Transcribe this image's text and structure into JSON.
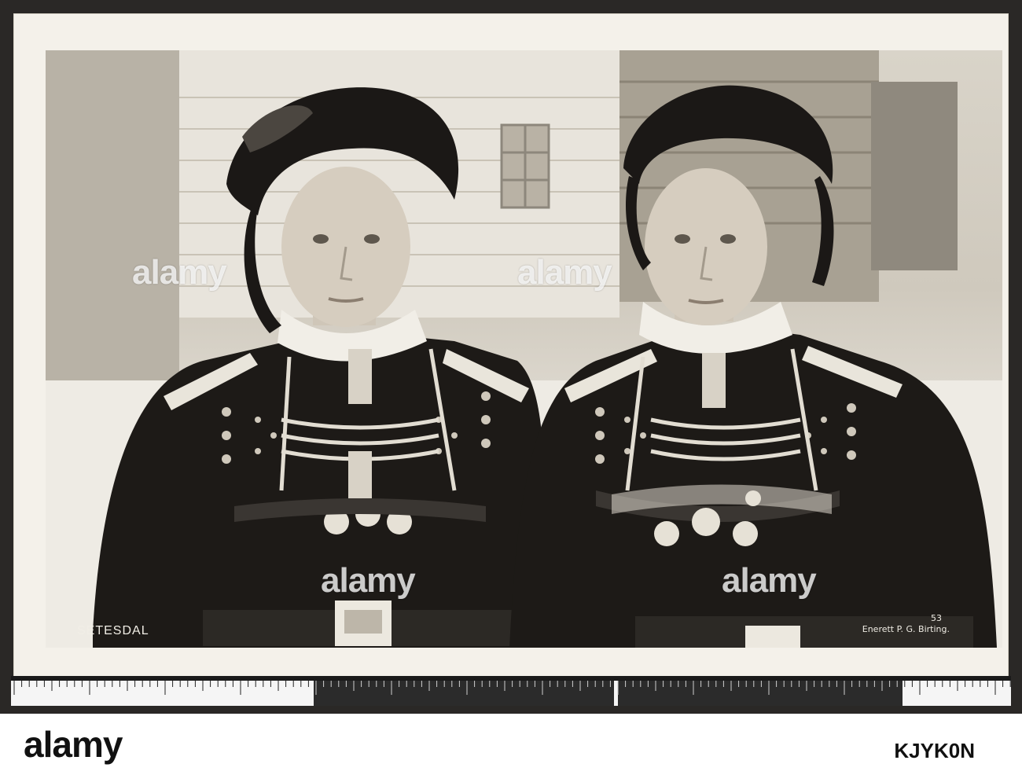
{
  "photo": {
    "caption_left": "SETESDAL",
    "caption_number": "53",
    "caption_credit": "Enerett P. G. Birting."
  },
  "watermark": {
    "text": "alamy"
  },
  "footer": {
    "logo_text": "alamy",
    "image_code": "KJYK0N"
  },
  "colors": {
    "costume_dark": "#1d1a17",
    "skin": "#d6cdbf",
    "silver": "#e2ddd2"
  }
}
